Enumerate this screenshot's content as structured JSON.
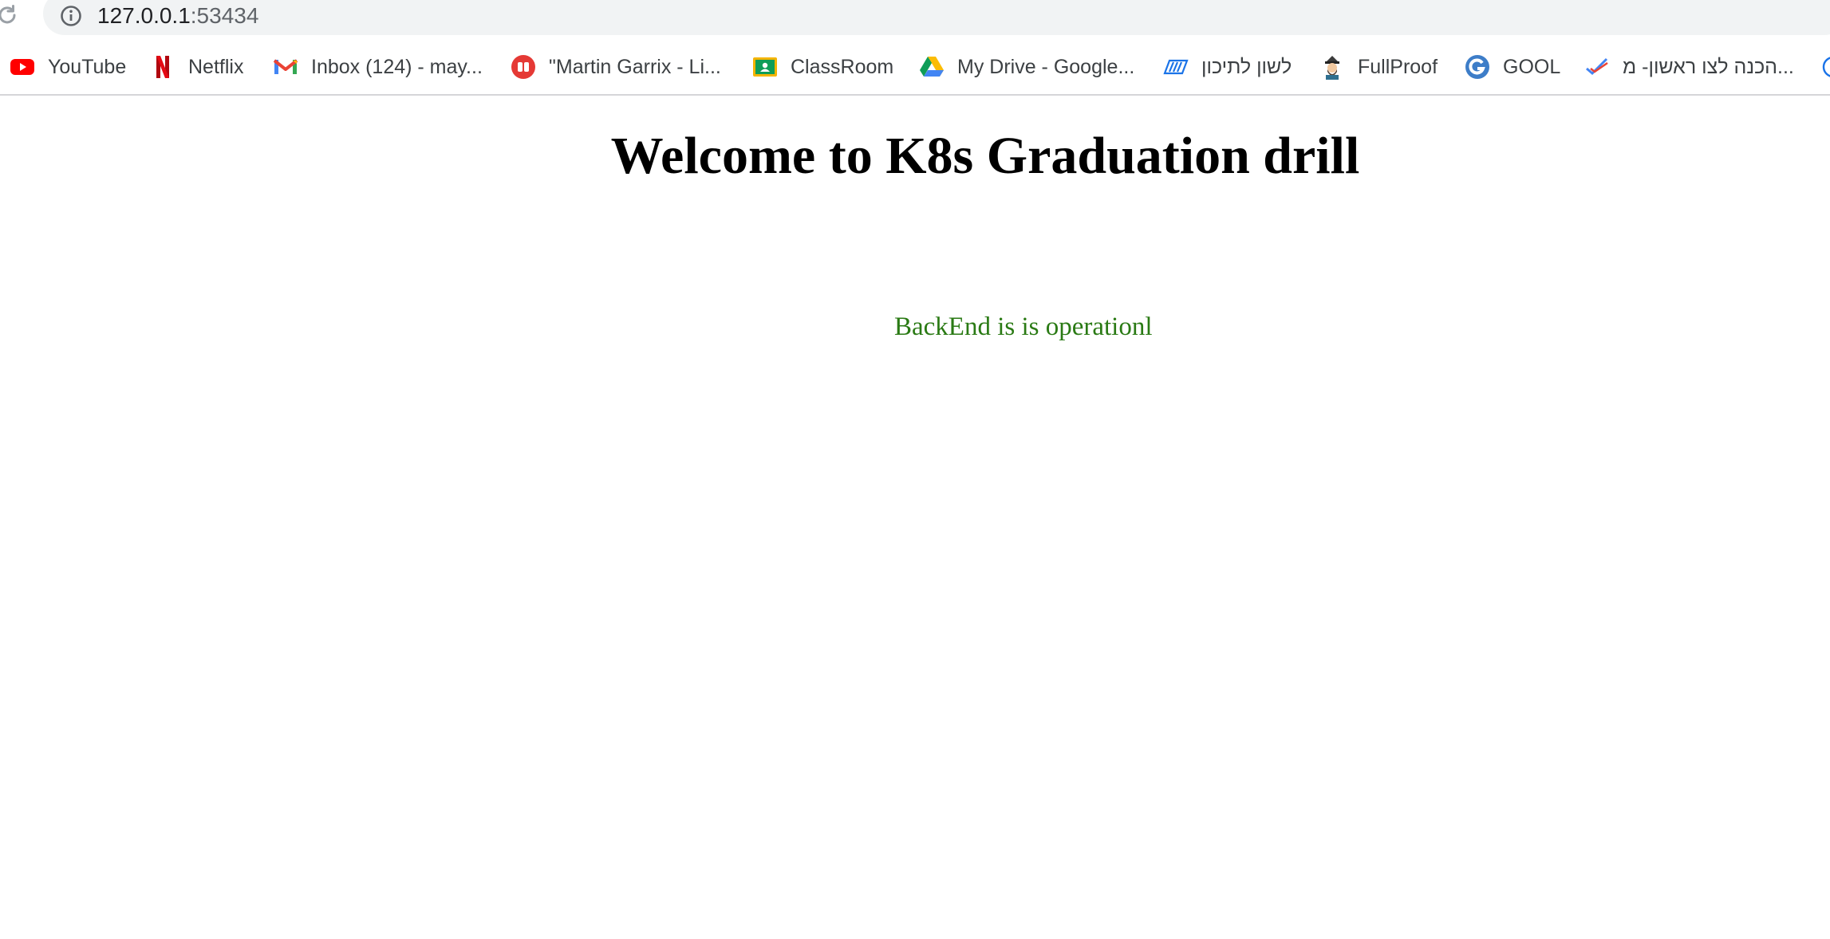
{
  "browser": {
    "address_bar": {
      "host": "127.0.0.1",
      "port": ":53434"
    },
    "bookmarks": [
      {
        "label": "YouTube",
        "icon": "youtube-icon"
      },
      {
        "label": "Netflix",
        "icon": "netflix-icon"
      },
      {
        "label": "Inbox (124) - may...",
        "icon": "gmail-icon"
      },
      {
        "label": "\"Martin Garrix - Li...",
        "icon": "music-icon"
      },
      {
        "label": "ClassRoom",
        "icon": "classroom-icon"
      },
      {
        "label": "My Drive - Google...",
        "icon": "google-drive-icon"
      },
      {
        "label": "לשון לתיכון",
        "icon": "stripes-icon"
      },
      {
        "label": "FullProof",
        "icon": "character-icon"
      },
      {
        "label": "GOOL",
        "icon": "gool-g-icon"
      },
      {
        "label": "הכנה לצו ראשון- מ...",
        "icon": "checkmark-icon"
      }
    ]
  },
  "page": {
    "title": "Welcome to K8s Graduation drill",
    "status": "BackEnd is is operationl",
    "status_color": "#2a7a14"
  }
}
